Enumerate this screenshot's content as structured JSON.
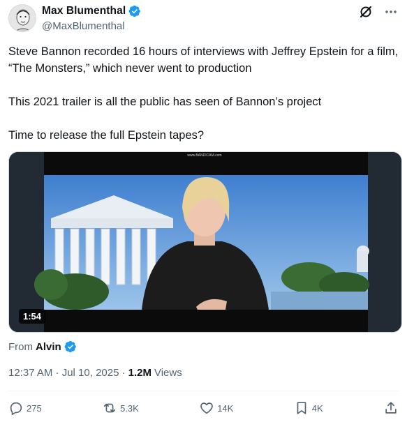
{
  "author": {
    "display_name": "Max Blumenthal",
    "handle": "@MaxBlumenthal"
  },
  "tweet": {
    "paragraphs": [
      "Steve Bannon recorded 16 hours of interviews with Jeffrey Epstein for a film, “The Monsters,” which never went to production",
      "This 2021 trailer is all the public has seen of Bannon’s project",
      "Time to release the full Epstein tapes?"
    ]
  },
  "media": {
    "duration": "1:54",
    "watermark": "www.BANDICAM.com"
  },
  "source": {
    "prefix": "From",
    "name": "Alvin"
  },
  "meta": {
    "timestamp": "12:37 AM · Jul 10, 2025 ·",
    "views_count": "1.2M",
    "views_label": "Views"
  },
  "actions": {
    "replies": "275",
    "reposts": "5.3K",
    "likes": "14K",
    "bookmarks": "4K"
  },
  "icons": [
    "verified-badge-icon",
    "grok-icon",
    "more-icon",
    "reply-icon",
    "repost-icon",
    "like-icon",
    "bookmark-icon",
    "share-icon"
  ],
  "colors": {
    "verified": "#1d9bf0",
    "secondary_text": "#536471",
    "primary_text": "#0f1419"
  }
}
